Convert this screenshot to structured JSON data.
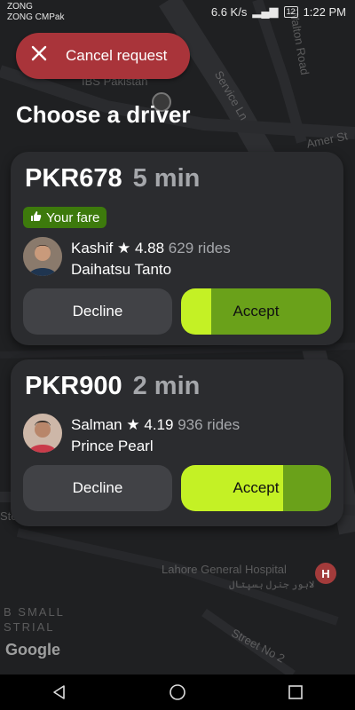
{
  "status_bar": {
    "carrier_1": "ZONG",
    "carrier_2": "ZONG CMPak",
    "network_speed": "6.6 K/s",
    "battery": "12",
    "time": "1:22 PM"
  },
  "map": {
    "labels": {
      "ibs": "IBS Pakistan",
      "walton": "Walton Road",
      "service": "Service Ln",
      "amer": "Amer St",
      "hospital": "Lahore General Hospital",
      "hospital_urdu": "لاہور جنرل ہسپتال",
      "small": "B SMALL",
      "strial": "STRIAL",
      "street2": "Street No 2",
      "stee": "Stee"
    },
    "hospital_marker": "H",
    "google": "Google"
  },
  "header": {
    "cancel_label": "Cancel request",
    "title": "Choose a driver"
  },
  "offers": [
    {
      "price": "PKR678",
      "eta": "5 min",
      "badge": "Your fare",
      "driver": "Kashif",
      "rating": "4.88",
      "rides": "629 rides",
      "car": "Daihatsu Tanto",
      "decline_label": "Decline",
      "accept_label": "Accept",
      "accept_timer_remaining": 0.8
    },
    {
      "price": "PKR900",
      "eta": "2 min",
      "driver": "Salman",
      "rating": "4.19",
      "rides": "936 rides",
      "car": "Prince Pearl",
      "decline_label": "Decline",
      "accept_label": "Accept",
      "accept_timer_remaining": 0.32
    }
  ],
  "colors": {
    "cancel": "#a9343a",
    "accept_light": "#c4f125",
    "accept_dark": "#6aa11a",
    "badge": "#3d7a0c",
    "card": "#2b2c2f"
  },
  "icons": {
    "cancel": "close-icon",
    "badge": "thumbs-up-icon",
    "rating": "star-icon",
    "nav": [
      "back-icon",
      "home-icon",
      "recents-icon"
    ]
  }
}
